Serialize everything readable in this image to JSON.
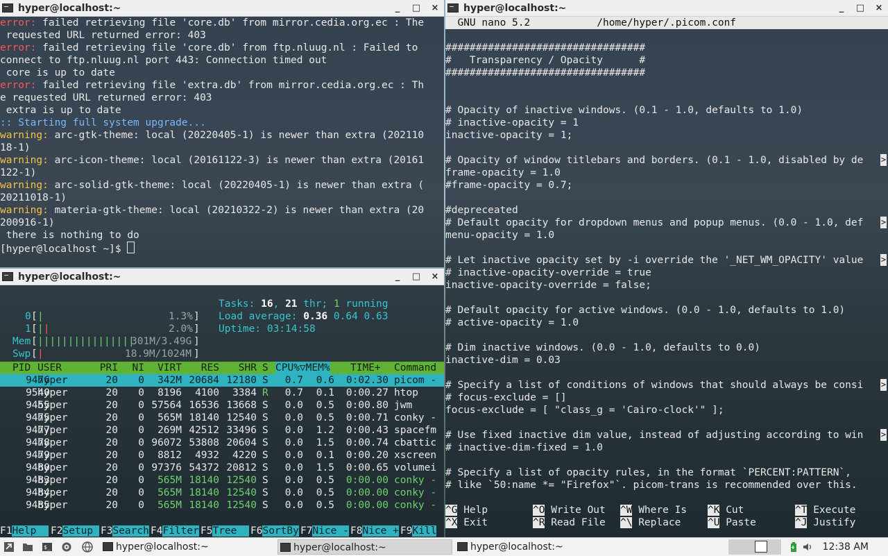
{
  "windows": {
    "pacman": {
      "title": "hyper@localhost:~",
      "lines": [
        [
          {
            "t": "error:",
            "c": "err"
          },
          {
            "t": " failed retrieving file 'core.db' from mirror.cedia.org.ec : The"
          }
        ],
        [
          {
            "t": " requested URL returned error: 403"
          }
        ],
        [
          {
            "t": "error:",
            "c": "err"
          },
          {
            "t": " failed retrieving file 'core.db' from ftp.nluug.nl : Failed to"
          }
        ],
        [
          {
            "t": "connect to ftp.nluug.nl port 443: Connection timed out"
          }
        ],
        [
          {
            "t": " core is up to date"
          }
        ],
        [
          {
            "t": "error:",
            "c": "err"
          },
          {
            "t": " failed retrieving file 'extra.db' from mirror.cedia.org.ec : Th"
          }
        ],
        [
          {
            "t": "e requested URL returned error: 403"
          }
        ],
        [
          {
            "t": " extra is up to date"
          }
        ],
        [
          {
            "t": ":: Starting full system upgrade...",
            "c": "info"
          }
        ],
        [
          {
            "t": "warning:",
            "c": "warn"
          },
          {
            "t": " arc-gtk-theme: local (20220405-1) is newer than extra (202110"
          }
        ],
        [
          {
            "t": "18-1)"
          }
        ],
        [
          {
            "t": "warning:",
            "c": "warn"
          },
          {
            "t": " arc-icon-theme: local (20161122-3) is newer than extra (20161"
          }
        ],
        [
          {
            "t": "122-1)"
          }
        ],
        [
          {
            "t": "warning:",
            "c": "warn"
          },
          {
            "t": " arc-solid-gtk-theme: local (20220405-1) is newer than extra ("
          }
        ],
        [
          {
            "t": "20211018-1)"
          }
        ],
        [
          {
            "t": "warning:",
            "c": "warn"
          },
          {
            "t": " materia-gtk-theme: local (20210322-2) is newer than extra (20"
          }
        ],
        [
          {
            "t": "200916-1)"
          }
        ],
        [
          {
            "t": " there is nothing to do"
          }
        ]
      ],
      "prompt": "[hyper@localhost ~]$ "
    },
    "htop": {
      "title": "hyper@localhost:~",
      "cpu0": {
        "label": "0",
        "value": "1.3%"
      },
      "cpu1": {
        "label": "1",
        "value": "2.0%"
      },
      "cpu0_usage": 0.013,
      "cpu1_usage": 0.02,
      "mem": {
        "label": "Mem",
        "value": "301M/3.49G"
      },
      "swp": {
        "label": "Swp",
        "value": "18.9M/1024M"
      },
      "tasks_label": "Tasks:",
      "tasks_count": "16",
      "threads": "21",
      "thr_label": "thr;",
      "running": "1",
      "running_label": "running",
      "load_label": "Load average:",
      "load1": "0.36",
      "load5": "0.64",
      "load15": "0.63",
      "uptime_label": "Uptime:",
      "uptime": "03:14:58",
      "headers": [
        "PID",
        "USER",
        "PRI",
        "NI",
        "VIRT",
        "RES",
        "SHR",
        "S",
        "CPU%▽MEM%",
        "TIME+",
        "Command"
      ],
      "rows": [
        [
          "9476",
          "hyper",
          "20",
          "0",
          "342M",
          "20684",
          "12180",
          "S",
          "0.7",
          "0.6",
          "0:02.30",
          "picom -"
        ],
        [
          "9540",
          "hyper",
          "20",
          "0",
          "8196",
          "4100",
          "3384",
          "R",
          "0.7",
          "0.1",
          "0:00.27",
          "htop"
        ],
        [
          "9455",
          "hyper",
          "20",
          "0",
          "57564",
          "16536",
          "13668",
          "S",
          "0.0",
          "0.5",
          "0:00.80",
          "jwm"
        ],
        [
          "9475",
          "hyper",
          "20",
          "0",
          "565M",
          "18140",
          "12540",
          "S",
          "0.0",
          "0.5",
          "0:00.71",
          "conky -"
        ],
        [
          "9477",
          "hyper",
          "20",
          "0",
          "269M",
          "42512",
          "33496",
          "S",
          "0.0",
          "1.2",
          "0:00.43",
          "spacefm"
        ],
        [
          "9478",
          "hyper",
          "20",
          "0",
          "96072",
          "53808",
          "20604",
          "S",
          "0.0",
          "1.5",
          "0:00.74",
          "cbattic"
        ],
        [
          "9479",
          "hyper",
          "20",
          "0",
          "8812",
          "4932",
          "4220",
          "S",
          "0.0",
          "0.1",
          "0:00.20",
          "xscreen"
        ],
        [
          "9480",
          "hyper",
          "20",
          "0",
          "97376",
          "54372",
          "20812",
          "S",
          "0.0",
          "1.5",
          "0:00.65",
          "volumei"
        ],
        [
          "9483",
          "hyper",
          "20",
          "0",
          "565M",
          "18140",
          "12540",
          "S",
          "0.0",
          "0.5",
          "0:00.00",
          "conky -"
        ],
        [
          "9484",
          "hyper",
          "20",
          "0",
          "565M",
          "18140",
          "12540",
          "S",
          "0.0",
          "0.5",
          "0:00.00",
          "conky -"
        ],
        [
          "9485",
          "hyper",
          "20",
          "0",
          "565M",
          "18140",
          "12540",
          "S",
          "0.0",
          "0.5",
          "0:00.00",
          "conky -"
        ]
      ],
      "fkeys": [
        {
          "k": "F1",
          "l": "Help  "
        },
        {
          "k": "F2",
          "l": "Setup "
        },
        {
          "k": "F3",
          "l": "Search"
        },
        {
          "k": "F4",
          "l": "Filter"
        },
        {
          "k": "F5",
          "l": "Tree  "
        },
        {
          "k": "F6",
          "l": "SortBy"
        },
        {
          "k": "F7",
          "l": "Nice -"
        },
        {
          "k": "F8",
          "l": "Nice +"
        },
        {
          "k": "F9",
          "l": "Kill"
        }
      ]
    },
    "nano": {
      "title": "hyper@localhost:~",
      "header": "  GNU nano 5.2           /home/hyper/.picom.conf",
      "lines": [
        "#################################",
        "#   Transparency / Opacity      #",
        "#################################",
        "",
        "",
        "# Opacity of inactive windows. (0.1 - 1.0, defaults to 1.0)",
        "# inactive-opacity = 1",
        "inactive-opacity = 1;",
        "",
        "# Opacity of window titlebars and borders. (0.1 - 1.0, disabled by de",
        "frame-opacity = 1.0",
        "#frame-opacity = 0.7;",
        "",
        "#depreceated",
        "# Default opacity for dropdown menus and popup menus. (0.0 - 1.0, def",
        "menu-opacity = 1.0",
        "",
        "# Let inactive opacity set by -i override the '_NET_WM_OPACITY' value",
        "# inactive-opacity-override = true",
        "inactive-opacity-override = false;",
        "",
        "# Default opacity for active windows. (0.0 - 1.0, defaults to 1.0)",
        "# active-opacity = 1.0",
        "",
        "# Dim inactive windows. (0.0 - 1.0, defaults to 0.0)",
        "inactive-dim = 0.03",
        "",
        "# Specify a list of conditions of windows that should always be consi",
        "# focus-exclude = []",
        "focus-exclude = [ \"class_g = 'Cairo-clock'\" ];",
        "",
        "# Use fixed inactive dim value, instead of adjusting according to win",
        "# inactive-dim-fixed = 1.0",
        "",
        "# Specify a list of opacity rules, in the format `PERCENT:PATTERN`,",
        "# like `50:name *= \"Firefox\"`. picom-trans is recommended over this."
      ],
      "shortcuts_top": [
        {
          "k": "^G",
          "l": "Help"
        },
        {
          "k": "^O",
          "l": "Write Out"
        },
        {
          "k": "^W",
          "l": "Where Is"
        },
        {
          "k": "^K",
          "l": "Cut"
        },
        {
          "k": "^T",
          "l": "Execute"
        }
      ],
      "shortcuts_bottom": [
        {
          "k": "^X",
          "l": "Exit"
        },
        {
          "k": "^R",
          "l": "Read File"
        },
        {
          "k": "^\\",
          "l": "Replace"
        },
        {
          "k": "^U",
          "l": "Paste"
        },
        {
          "k": "^J",
          "l": "Justify"
        }
      ]
    }
  },
  "taskbar": {
    "tasks": [
      "hyper@localhost:~",
      "hyper@localhost:~",
      "hyper@localhost:~"
    ],
    "clock": "12:38 AM"
  },
  "window_buttons": {
    "minimize": "_",
    "maximize": "□",
    "close": "×"
  },
  "icons": [
    "menu-icon",
    "folder-icon",
    "terminal-icon",
    "globe-icon",
    "terminal-icon",
    "battery-icon",
    "volume-icon"
  ]
}
